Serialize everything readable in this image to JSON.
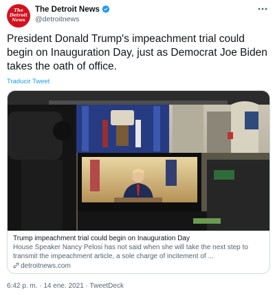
{
  "account": {
    "display_name": "The Detroit News",
    "handle": "@detroitnews",
    "avatar_text": [
      "The",
      "Detroit",
      "News"
    ],
    "verified": true,
    "avatar_color": "#d3121f"
  },
  "tweet": {
    "text": "President Donald Trump's impeachment trial could begin on Inauguration Day, just as Democrat Joe Biden takes the oath of office.",
    "translate_label": "Traducir Tweet"
  },
  "card": {
    "title": "Trump impeachment trial could begin on Inauguration Day",
    "description": "House Speaker Nancy Pelosi has not said when she will take the next step to transmit the impeachment article, a sole charge of incitement of ...",
    "domain": "detroitnews.com",
    "image_icon": "press-briefing-room-photo"
  },
  "meta": {
    "time": "6:42 p. m.",
    "separator": "·",
    "date": "14 ene. 2021",
    "source": "TweetDeck"
  },
  "colors": {
    "link_blue": "#1d9bf0",
    "secondary_text": "#536471",
    "border": "#cfd9de"
  }
}
